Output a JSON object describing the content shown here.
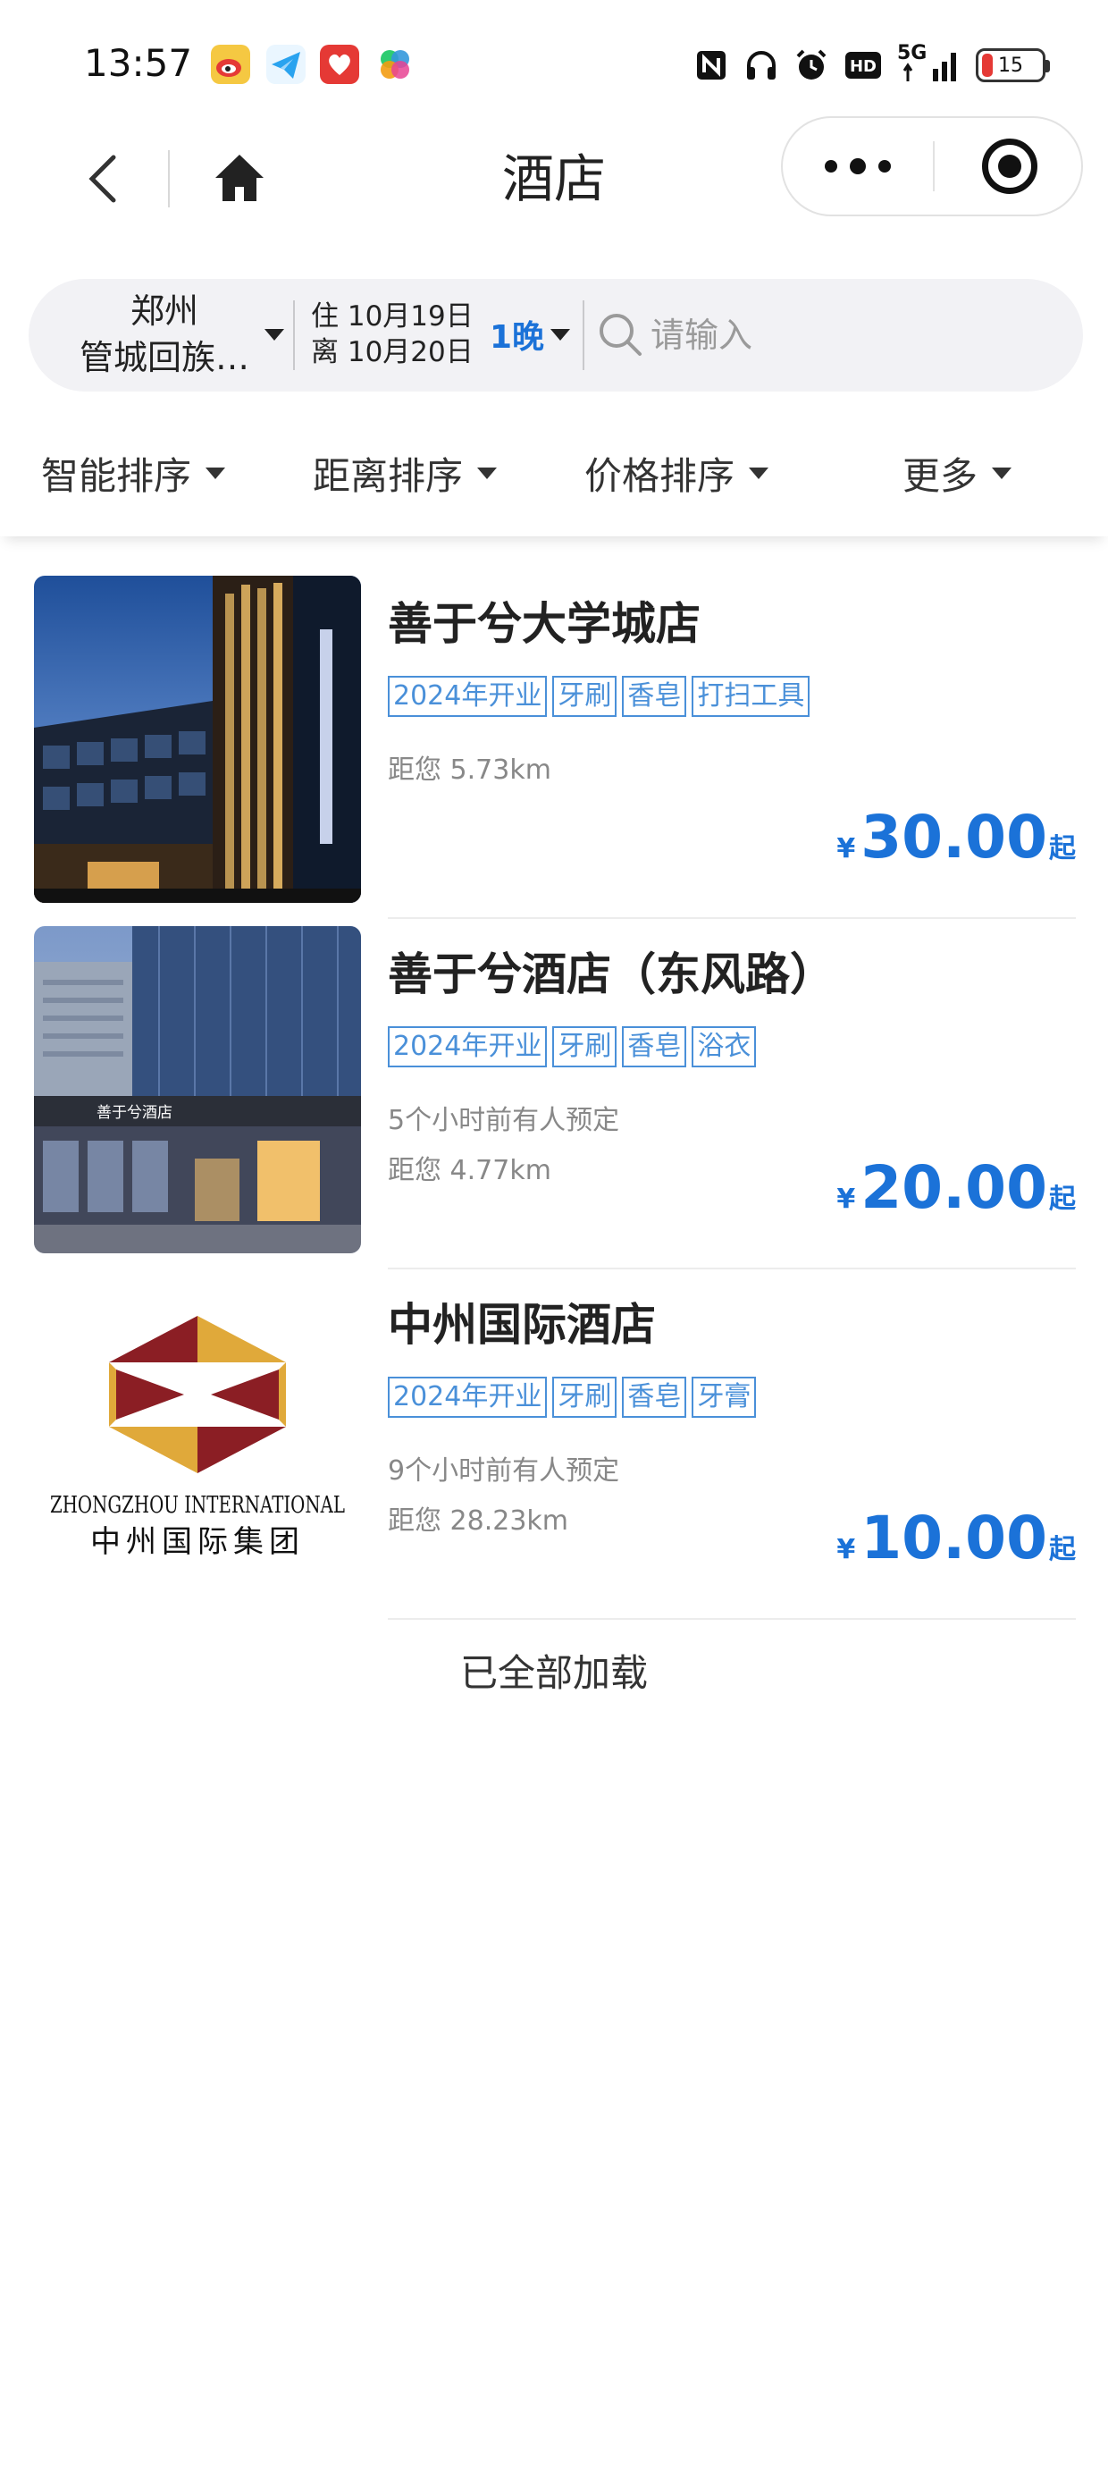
{
  "status_bar": {
    "time": "13:57",
    "notification_icons": [
      "weibo-icon",
      "telegram-icon",
      "heart-app-icon",
      "colorful-app-icon"
    ],
    "system_icons": [
      "nfc-icon",
      "headphone-icon",
      "alarm-icon",
      "hd-icon",
      "signal-5g-icon"
    ],
    "network_label": "5G",
    "hd_label": "HD",
    "battery_level": "15"
  },
  "nav": {
    "title": "酒店"
  },
  "search": {
    "city": "郑州",
    "district": "管城回族…",
    "checkin": "住 10月19日",
    "checkout": "离 10月20日",
    "nights": "1晚",
    "placeholder": "请输入"
  },
  "sort": {
    "items": [
      "智能排序",
      "距离排序",
      "价格排序",
      "更多"
    ]
  },
  "hotels": [
    {
      "name": "善于兮大学城店",
      "tags": [
        "2024年开业",
        "牙刷",
        "香皂",
        "打扫工具"
      ],
      "booked": "",
      "distance": "距您 5.73km",
      "currency": "¥",
      "price": "30.00",
      "price_suffix": "起"
    },
    {
      "name": "善于兮酒店（东风路）",
      "tags": [
        "2024年开业",
        "牙刷",
        "香皂",
        "浴衣"
      ],
      "booked": "5个小时前有人预定",
      "distance": "距您 4.77km",
      "currency": "¥",
      "price": "20.00",
      "price_suffix": "起",
      "image_sign": "善于兮酒店"
    },
    {
      "name": "中州国际酒店",
      "tags": [
        "2024年开业",
        "牙刷",
        "香皂",
        "牙膏"
      ],
      "booked": "9个小时前有人预定",
      "distance": "距您 28.23km",
      "currency": "¥",
      "price": "10.00",
      "price_suffix": "起",
      "logo_en": "ZHONGZHOU INTERNATIONAL",
      "logo_cn": "中州国际集团"
    }
  ],
  "footer": {
    "load_all": "已全部加载"
  },
  "colors": {
    "accent": "#1b72d8",
    "tag": "#4a90d9",
    "logo_gold": "#e0a93a",
    "logo_red": "#8b1e24"
  }
}
